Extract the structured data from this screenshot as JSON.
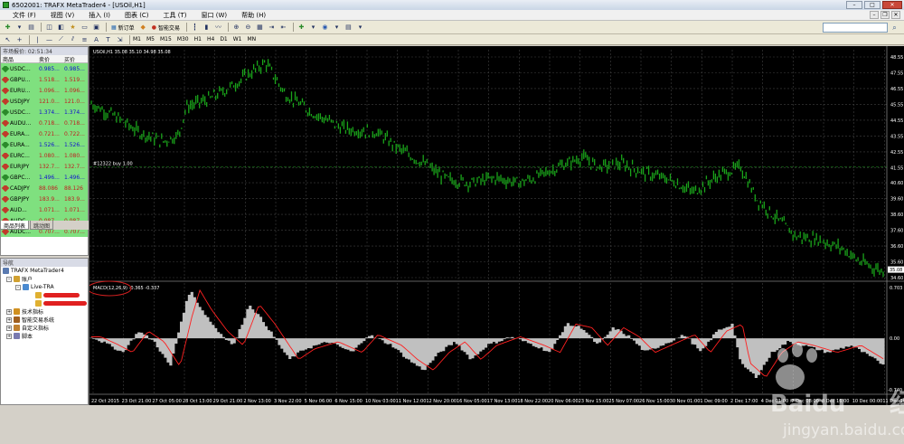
{
  "window": {
    "title": "6502001: TRAFX MetaTrader4 - [USOil,H1]"
  },
  "menu": [
    "文件 (F)",
    "视图 (V)",
    "插入 (I)",
    "图表 (C)",
    "工具 (T)",
    "窗口 (W)",
    "帮助 (H)"
  ],
  "toolbar": {
    "new_order": "新订单",
    "expert_trading": "智能交易"
  },
  "timeframes": [
    "M1",
    "M5",
    "M15",
    "M30",
    "H1",
    "H4",
    "D1",
    "W1",
    "MN"
  ],
  "market_watch": {
    "header": "市场报价: 02:51:34",
    "col_symbol": "商品",
    "col_bid": "卖价",
    "col_ask": "买价",
    "rows": [
      {
        "symbol": "USDC...",
        "bid": "0.985...",
        "ask": "0.985...",
        "dir": "up"
      },
      {
        "symbol": "GBPU...",
        "bid": "1.518...",
        "ask": "1.519...",
        "dir": "down"
      },
      {
        "symbol": "EURU...",
        "bid": "1.096...",
        "ask": "1.096...",
        "dir": "down"
      },
      {
        "symbol": "USDJPY",
        "bid": "121.0...",
        "ask": "121.0...",
        "dir": "down"
      },
      {
        "symbol": "USDC...",
        "bid": "1.374...",
        "ask": "1.374...",
        "dir": "up"
      },
      {
        "symbol": "AUDU...",
        "bid": "0.718...",
        "ask": "0.718...",
        "dir": "down"
      },
      {
        "symbol": "EURA...",
        "bid": "0.721...",
        "ask": "0.722...",
        "dir": "down"
      },
      {
        "symbol": "EURA...",
        "bid": "1.526...",
        "ask": "1.526...",
        "dir": "up"
      },
      {
        "symbol": "EURC...",
        "bid": "1.080...",
        "ask": "1.080...",
        "dir": "down"
      },
      {
        "symbol": "EURJPY",
        "bid": "132.7...",
        "ask": "132.7...",
        "dir": "down"
      },
      {
        "symbol": "GBPC...",
        "bid": "1.496...",
        "ask": "1.496...",
        "dir": "up"
      },
      {
        "symbol": "CADJPY",
        "bid": "88.086",
        "ask": "88.126",
        "dir": "down"
      },
      {
        "symbol": "GBPJPY",
        "bid": "183.9...",
        "ask": "183.9...",
        "dir": "down"
      },
      {
        "symbol": "AUD...",
        "bid": "1.071...",
        "ask": "1.071...",
        "dir": "down"
      },
      {
        "symbol": "AUDC...",
        "bid": "0.987...",
        "ask": "0.987...",
        "dir": "down"
      },
      {
        "symbol": "AUDC...",
        "bid": "0.707...",
        "ask": "0.707...",
        "dir": "down"
      }
    ],
    "tabs": [
      "商品列表",
      "跳动图"
    ]
  },
  "navigator": {
    "header": "导航",
    "root": "TRAFX MetaTrader4",
    "accounts": "账户",
    "server": "Live-TRA",
    "items": [
      "技术指标",
      "智能交易系统",
      "自定义指标",
      "脚本"
    ]
  },
  "chart": {
    "symbol_info": "USOil,H1  35.08 35.10 34.98 35.08",
    "order_label": "#12322 buy 1.00",
    "price_axis": [
      "48.55",
      "47.55",
      "46.55",
      "45.55",
      "44.55",
      "43.55",
      "42.55",
      "41.55",
      "40.60",
      "39.60",
      "38.60",
      "37.60",
      "36.60",
      "35.60",
      "34.60"
    ],
    "price_current": "35.08",
    "order_price": 41.6,
    "macd_label": "MACD(12,26,9) -0.365 -0.337",
    "macd_axis_top": "0.703",
    "macd_axis_zero": "0.00",
    "macd_axis_bottom": "-0.740",
    "time_axis": [
      "22 Oct 2015",
      "23 Oct 21:00",
      "27 Oct 05:00",
      "28 Oct 13:00",
      "29 Oct 21:00",
      "2 Nov 13:00",
      "3 Nov 22:00",
      "5 Nov 06:00",
      "6 Nov 15:00",
      "10 Nov 03:00",
      "11 Nov 12:00",
      "12 Nov 20:00",
      "16 Nov 05:00",
      "17 Nov 13:00",
      "18 Nov 22:00",
      "20 Nov 06:00",
      "23 Nov 15:00",
      "25 Nov 07:00",
      "26 Nov 15:00",
      "30 Nov 01:00",
      "1 Dec 09:00",
      "2 Dec 17:00",
      "4 Dec 01:00",
      "7 Dec 08:00",
      "8 Dec 16:00",
      "10 Dec 00:00",
      "11 Dec 16:00"
    ],
    "colors": {
      "candles": "#1aa31a",
      "grid": "#404040",
      "order_line": "#1a7a1a",
      "macd_hist": "#c0c0c0",
      "macd_signal": "#ff2020"
    }
  },
  "watermark": {
    "brand": "Baidu",
    "cn": "经验",
    "url": "jingyan.baidu.com"
  }
}
